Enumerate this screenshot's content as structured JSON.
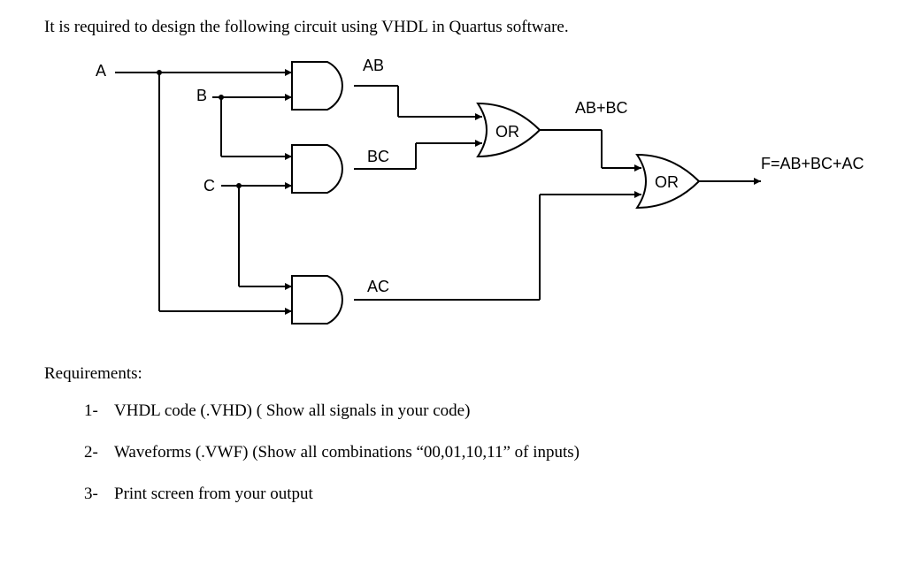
{
  "intro": "It is required to design the following circuit using VHDL in Quartus software.",
  "diagram": {
    "inputA": "A",
    "inputB": "B",
    "inputC": "C",
    "signal_AB": "AB",
    "signal_BC": "BC",
    "signal_AC": "AC",
    "signal_ABpBC": "AB+BC",
    "gate_or1": "OR",
    "gate_or2": "OR",
    "output_F": "F=AB+BC+AC"
  },
  "requirements_heading": "Requirements:",
  "requirements": [
    {
      "num": "1-",
      "text": "VHDL code  (.VHD)   ( Show all signals in your code)"
    },
    {
      "num": "2-",
      "text": " Waveforms (.VWF)   (Show all combinations “00,01,10,11” of inputs)"
    },
    {
      "num": "3-",
      "text": "Print screen from your output"
    }
  ]
}
